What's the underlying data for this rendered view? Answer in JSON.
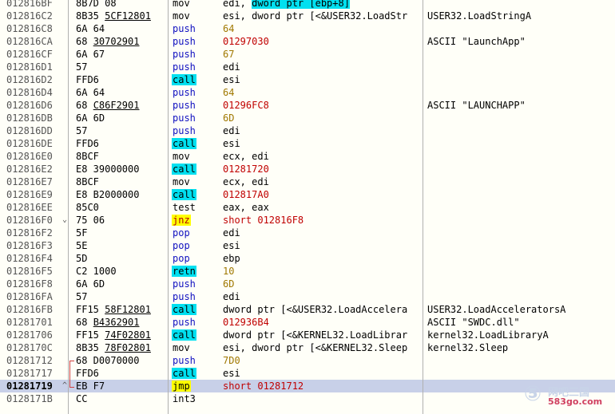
{
  "disasm": {
    "rows": [
      {
        "addr": "012816BF",
        "arrow": "",
        "hex": [
          "8B7D 08"
        ],
        "mnem": "mov",
        "mnem_style": "",
        "opnd": [
          {
            "t": "edi, "
          },
          {
            "t": "dword ptr [ebp+8]",
            "c": "sel"
          }
        ],
        "comment": ""
      },
      {
        "addr": "012816C2",
        "arrow": "",
        "hex": [
          "8B35 ",
          {
            "f": "5CF12801"
          }
        ],
        "mnem": "mov",
        "mnem_style": "",
        "opnd": [
          {
            "t": "esi, dword ptr [<&USER32.LoadStr"
          }
        ],
        "comment": "USER32.LoadStringA"
      },
      {
        "addr": "012816C8",
        "arrow": "",
        "hex": [
          "6A 64"
        ],
        "mnem": "push",
        "mnem_style": "blue",
        "opnd": [
          {
            "t": "64",
            "c": "num"
          }
        ],
        "comment": ""
      },
      {
        "addr": "012816CA",
        "arrow": "",
        "hex": [
          "68 ",
          {
            "f": "30702901"
          }
        ],
        "mnem": "push",
        "mnem_style": "blue",
        "opnd": [
          {
            "t": "01297030",
            "c": "imm-red"
          }
        ],
        "comment": "ASCII \"LaunchApp\""
      },
      {
        "addr": "012816CF",
        "arrow": "",
        "hex": [
          "6A 67"
        ],
        "mnem": "push",
        "mnem_style": "blue",
        "opnd": [
          {
            "t": "67",
            "c": "num"
          }
        ],
        "comment": ""
      },
      {
        "addr": "012816D1",
        "arrow": "",
        "hex": [
          "57"
        ],
        "mnem": "push",
        "mnem_style": "blue",
        "opnd": [
          {
            "t": "edi"
          }
        ],
        "comment": ""
      },
      {
        "addr": "012816D2",
        "arrow": "",
        "hex": [
          "FFD6"
        ],
        "mnem": "call",
        "mnem_style": "hl-call",
        "opnd": [
          {
            "t": "esi"
          }
        ],
        "comment": ""
      },
      {
        "addr": "012816D4",
        "arrow": "",
        "hex": [
          "6A 64"
        ],
        "mnem": "push",
        "mnem_style": "blue",
        "opnd": [
          {
            "t": "64",
            "c": "num"
          }
        ],
        "comment": ""
      },
      {
        "addr": "012816D6",
        "arrow": "",
        "hex": [
          "68 ",
          {
            "f": "C86F2901"
          }
        ],
        "mnem": "push",
        "mnem_style": "blue",
        "opnd": [
          {
            "t": "01296FC8",
            "c": "imm-red"
          }
        ],
        "comment": "ASCII \"LAUNCHAPP\""
      },
      {
        "addr": "012816DB",
        "arrow": "",
        "hex": [
          "6A 6D"
        ],
        "mnem": "push",
        "mnem_style": "blue",
        "opnd": [
          {
            "t": "6D",
            "c": "num"
          }
        ],
        "comment": ""
      },
      {
        "addr": "012816DD",
        "arrow": "",
        "hex": [
          "57"
        ],
        "mnem": "push",
        "mnem_style": "blue",
        "opnd": [
          {
            "t": "edi"
          }
        ],
        "comment": ""
      },
      {
        "addr": "012816DE",
        "arrow": "",
        "hex": [
          "FFD6"
        ],
        "mnem": "call",
        "mnem_style": "hl-call",
        "opnd": [
          {
            "t": "esi"
          }
        ],
        "comment": ""
      },
      {
        "addr": "012816E0",
        "arrow": "",
        "hex": [
          "8BCF"
        ],
        "mnem": "mov",
        "mnem_style": "",
        "opnd": [
          {
            "t": "ecx, edi"
          }
        ],
        "comment": ""
      },
      {
        "addr": "012816E2",
        "arrow": "",
        "hex": [
          "E8 39000000"
        ],
        "mnem": "call",
        "mnem_style": "hl-call",
        "opnd": [
          {
            "t": "01281720",
            "c": "imm-red"
          }
        ],
        "comment": ""
      },
      {
        "addr": "012816E7",
        "arrow": "",
        "hex": [
          "8BCF"
        ],
        "mnem": "mov",
        "mnem_style": "",
        "opnd": [
          {
            "t": "ecx, edi"
          }
        ],
        "comment": ""
      },
      {
        "addr": "012816E9",
        "arrow": "",
        "hex": [
          "E8 B2000000"
        ],
        "mnem": "call",
        "mnem_style": "hl-call",
        "opnd": [
          {
            "t": "012817A0",
            "c": "imm-red"
          }
        ],
        "comment": ""
      },
      {
        "addr": "012816EE",
        "arrow": "",
        "hex": [
          "85C0"
        ],
        "mnem": "test",
        "mnem_style": "",
        "opnd": [
          {
            "t": "eax, eax"
          }
        ],
        "comment": ""
      },
      {
        "addr": "012816F0",
        "arrow": "⌄",
        "hex": [
          "75 06"
        ],
        "mnem": "jnz",
        "mnem_style": "hl-jcc",
        "opnd": [
          {
            "t": "short 012816F8",
            "c": "imm-red"
          }
        ],
        "comment": ""
      },
      {
        "addr": "012816F2",
        "arrow": "",
        "hex": [
          "5F"
        ],
        "mnem": "pop",
        "mnem_style": "blue",
        "opnd": [
          {
            "t": "edi"
          }
        ],
        "comment": ""
      },
      {
        "addr": "012816F3",
        "arrow": "",
        "hex": [
          "5E"
        ],
        "mnem": "pop",
        "mnem_style": "blue",
        "opnd": [
          {
            "t": "esi"
          }
        ],
        "comment": ""
      },
      {
        "addr": "012816F4",
        "arrow": "",
        "hex": [
          "5D"
        ],
        "mnem": "pop",
        "mnem_style": "blue",
        "opnd": [
          {
            "t": "ebp"
          }
        ],
        "comment": ""
      },
      {
        "addr": "012816F5",
        "arrow": "",
        "hex": [
          "C2 1000"
        ],
        "mnem": "retn",
        "mnem_style": "hl-ret",
        "opnd": [
          {
            "t": "10",
            "c": "num"
          }
        ],
        "comment": ""
      },
      {
        "addr": "012816F8",
        "arrow": "",
        "hex": [
          "6A 6D"
        ],
        "mnem": "push",
        "mnem_style": "blue",
        "opnd": [
          {
            "t": "6D",
            "c": "num"
          }
        ],
        "comment": ""
      },
      {
        "addr": "012816FA",
        "arrow": "",
        "hex": [
          "57"
        ],
        "mnem": "push",
        "mnem_style": "blue",
        "opnd": [
          {
            "t": "edi"
          }
        ],
        "comment": ""
      },
      {
        "addr": "012816FB",
        "arrow": "",
        "hex": [
          "FF15 ",
          {
            "f": "58F12801"
          }
        ],
        "mnem": "call",
        "mnem_style": "hl-call",
        "opnd": [
          {
            "t": "dword ptr [<&USER32.LoadAccelera"
          }
        ],
        "comment": "USER32.LoadAcceleratorsA"
      },
      {
        "addr": "01281701",
        "arrow": "",
        "hex": [
          "68 ",
          {
            "f": "B4362901"
          }
        ],
        "mnem": "push",
        "mnem_style": "blue",
        "opnd": [
          {
            "t": "012936B4",
            "c": "imm-red"
          }
        ],
        "comment": "ASCII \"SWDC.dll\""
      },
      {
        "addr": "01281706",
        "arrow": "",
        "hex": [
          "FF15 ",
          {
            "f": "74F02801"
          }
        ],
        "mnem": "call",
        "mnem_style": "hl-call",
        "opnd": [
          {
            "t": "dword ptr [<&KERNEL32.LoadLibrar"
          }
        ],
        "comment": "kernel32.LoadLibraryA"
      },
      {
        "addr": "0128170C",
        "arrow": "",
        "hex": [
          "8B35 ",
          {
            "f": "78F02801"
          }
        ],
        "mnem": "mov",
        "mnem_style": "",
        "opnd": [
          {
            "t": "esi, dword ptr [<&KERNEL32.Sleep"
          }
        ],
        "comment": "kernel32.Sleep"
      },
      {
        "addr": "01281712",
        "arrow": "",
        "hex": [
          "68 D0070000"
        ],
        "mnem": "push",
        "mnem_style": "blue",
        "opnd": [
          {
            "t": "7D0",
            "c": "num"
          }
        ],
        "comment": ""
      },
      {
        "addr": "01281717",
        "arrow": "",
        "hex": [
          "FFD6"
        ],
        "mnem": "call",
        "mnem_style": "hl-call",
        "opnd": [
          {
            "t": "esi"
          }
        ],
        "comment": ""
      },
      {
        "addr": "01281719",
        "arrow": "^",
        "hex": [
          "EB F7"
        ],
        "mnem": "jmp",
        "mnem_style": "hl-jmp",
        "opnd": [
          {
            "t": "short 01281712",
            "c": "imm-red"
          }
        ],
        "comment": "",
        "selected": true
      },
      {
        "addr": "0128171B",
        "arrow": "",
        "hex": [
          "CC"
        ],
        "mnem": "int3",
        "mnem_style": "",
        "opnd": [],
        "comment": ""
      }
    ]
  },
  "watermark": {
    "glyph": "⑤",
    "main": "网吧三国",
    "site": "583go.com"
  }
}
